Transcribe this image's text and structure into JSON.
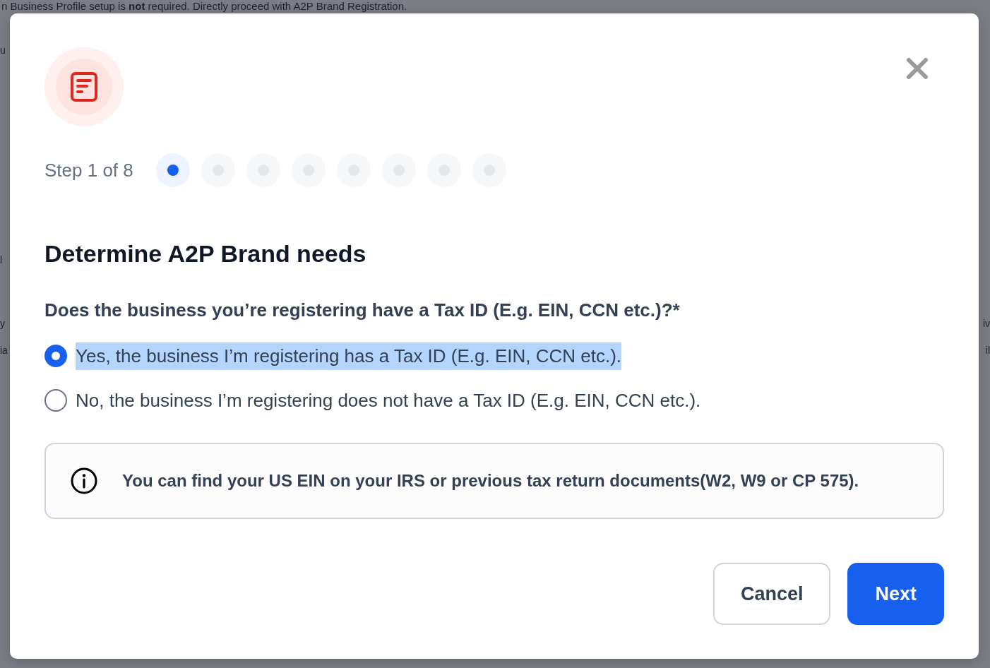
{
  "background": {
    "notice": "n Business Profile setup is **not** required. Directly proceed with A2P Brand Registration.",
    "left_fragments": [
      "u",
      "l",
      "y",
      "ia"
    ],
    "right_fragments": [
      "iv",
      "il"
    ]
  },
  "modal": {
    "step_label": "Step 1 of 8",
    "steps": [
      {
        "selected": true
      },
      {
        "selected": false
      },
      {
        "selected": false
      },
      {
        "selected": false
      },
      {
        "selected": false
      },
      {
        "selected": false
      },
      {
        "selected": false
      },
      {
        "selected": false
      }
    ],
    "title": "Determine A2P Brand needs",
    "question": "Does the business you’re registering have a Tax ID (E.g. EIN, CCN etc.)?*",
    "options": [
      {
        "label": "Yes, the business I’m registering has a Tax ID (E.g. EIN, CCN etc.).",
        "selected": true,
        "highlighted": true
      },
      {
        "label": "No, the business I’m registering does not have a Tax ID (E.g. EIN, CCN etc.).",
        "selected": false,
        "highlighted": false
      }
    ],
    "info": "You can find your US EIN on your IRS or previous tax return documents(W2, W9 or CP 575).",
    "buttons": [
      {
        "label": "Cancel",
        "kind": "secondary"
      },
      {
        "label": "Next",
        "kind": "primary"
      }
    ]
  }
}
